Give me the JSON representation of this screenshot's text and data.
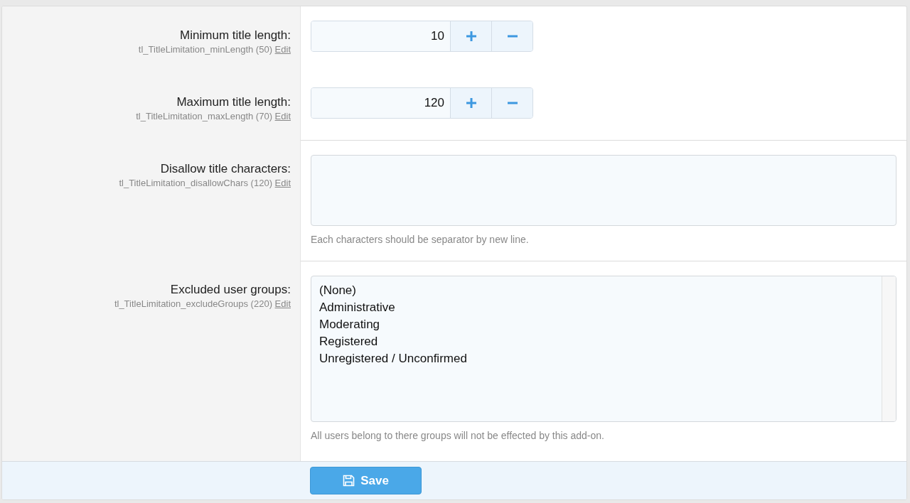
{
  "groups": [
    {
      "options": [
        {
          "kind": "spinner",
          "label": "Minimum title length:",
          "phrase": "tl_TitleLimitation_minLength (50)",
          "edit_link": "Edit",
          "value": "10"
        },
        {
          "kind": "spinner",
          "label": "Maximum title length:",
          "phrase": "tl_TitleLimitation_maxLength (70)",
          "edit_link": "Edit",
          "value": "120"
        }
      ]
    },
    {
      "options": [
        {
          "kind": "textarea",
          "label": "Disallow title characters:",
          "phrase": "tl_TitleLimitation_disallowChars (120)",
          "edit_link": "Edit",
          "hint": "Each characters should be separator by new line."
        }
      ]
    },
    {
      "options": [
        {
          "kind": "select",
          "label": "Excluded user groups:",
          "phrase": "tl_TitleLimitation_excludeGroups (220)",
          "edit_link": "Edit",
          "hint": "All users belong to there groups will not be effected by this add-on.",
          "items": [
            {
              "label": "(None)",
              "selected": false
            },
            {
              "label": "Administrative",
              "selected": false
            },
            {
              "label": "Moderating",
              "selected": false
            },
            {
              "label": "Registered",
              "selected": false
            },
            {
              "label": "Unregistered / Unconfirmed",
              "selected": false
            }
          ]
        }
      ]
    }
  ],
  "save_button": "Save"
}
